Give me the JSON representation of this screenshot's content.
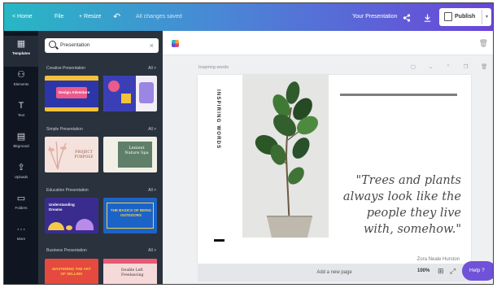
{
  "topbar": {
    "home": "< Home",
    "file": "File",
    "resize": "+ Resize",
    "undo": "↶",
    "saved": "All changes saved",
    "presentation_name": "Your Presentation",
    "share_icon": "share-icon",
    "download_icon": "download-icon",
    "publish": "Publish",
    "publish_dropdown": "▾",
    "gradient": [
      "#27b7c4",
      "#4a86d6",
      "#6b45d8"
    ]
  },
  "rail": [
    {
      "icon": "▦",
      "label": "Templates"
    },
    {
      "icon": "⚇",
      "label": "Elements"
    },
    {
      "icon": "T",
      "label": "Text"
    },
    {
      "icon": "▤",
      "label": "Bkground"
    },
    {
      "icon": "⇪",
      "label": "Uploads"
    },
    {
      "icon": "▭",
      "label": "Folders"
    },
    {
      "icon": "···",
      "label": "More"
    }
  ],
  "panel": {
    "search_value": "Presentation",
    "clear": "×",
    "all_label": "All >",
    "sections": [
      {
        "title": "Creative Presentation",
        "thumbs": [
          {
            "text": "Design Adventure"
          },
          {
            "text": ""
          }
        ]
      },
      {
        "title": "Simple Presentation",
        "thumbs": [
          {
            "text": "PROJECT PURPOSE"
          },
          {
            "text": "Lenient Nature Spa"
          }
        ]
      },
      {
        "title": "Education Presentation",
        "thumbs": [
          {
            "text": "Understanding Dreams"
          },
          {
            "text": "THE BASICS OF BEING OUTDOORS"
          }
        ]
      },
      {
        "title": "Business Presentation",
        "thumbs": [
          {
            "text": "MASTERING THE ART OF SELLING"
          },
          {
            "text": "Double Left Freelancing"
          }
        ]
      }
    ]
  },
  "canvas": {
    "page_label": "Inspiring words",
    "page_controls": "▢ ⌄ ⌃ ❐ 🗑",
    "vertical_text": "INSPIRING WORDS",
    "quote": "\"Trees and plants always look like the people they live with, somehow.\"",
    "author": "Zora Neale Hurston",
    "add_page": "Add a new page",
    "zoom": "100%",
    "help": "Help ?"
  }
}
